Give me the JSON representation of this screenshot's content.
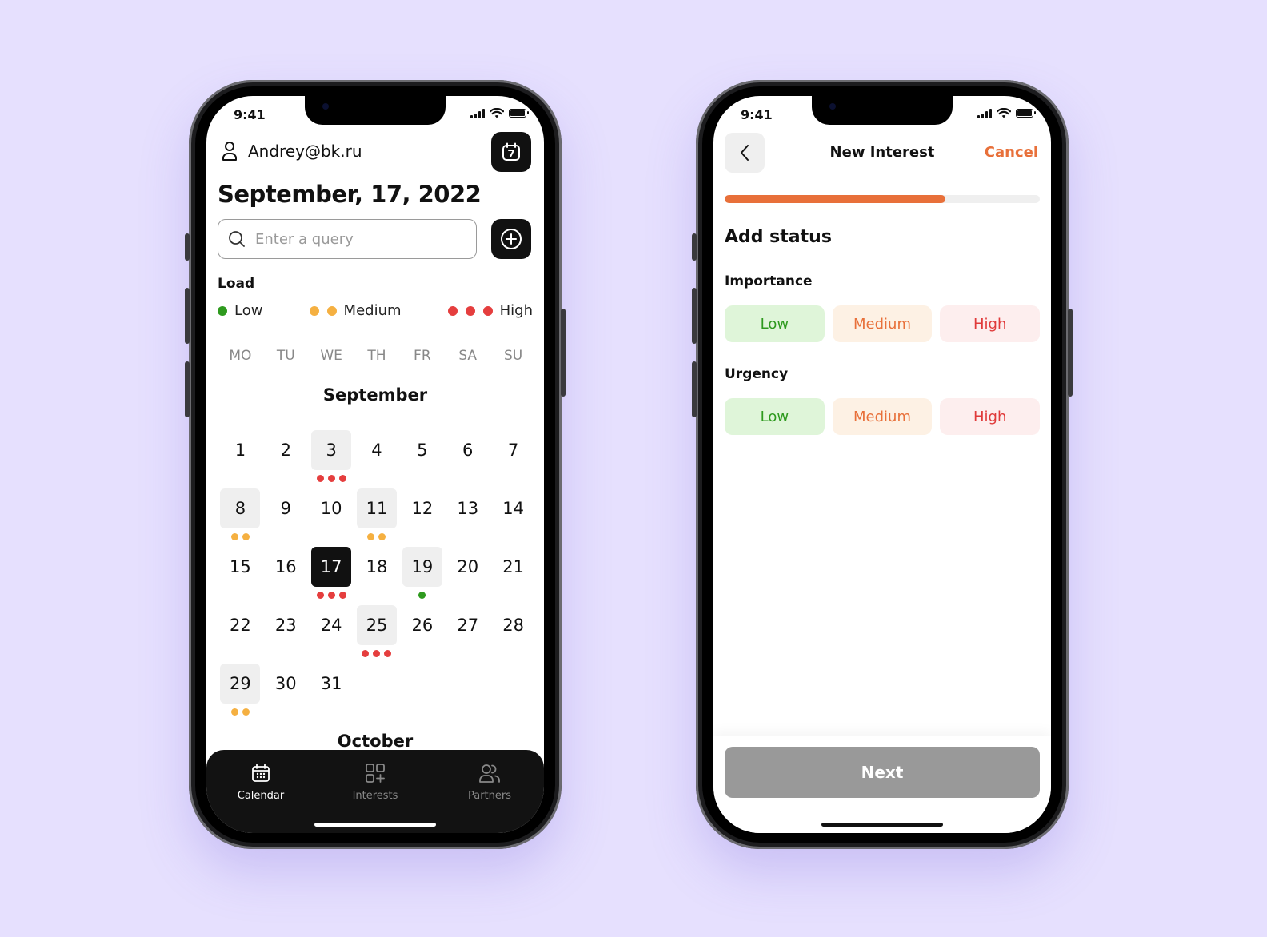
{
  "colors": {
    "background": "#e6e0fe",
    "accent": "#e8703a",
    "low": "#2e9a1e",
    "medium": "#f5b041",
    "high": "#e53e3e"
  },
  "calendar_screen": {
    "status_time": "9:41",
    "user_email": "Andrey@bk.ru",
    "calendar_button_icon": "calendar-7-icon",
    "date_title": "September, 17, 2022",
    "search": {
      "placeholder": "Enter a query",
      "value": ""
    },
    "load": {
      "label": "Load",
      "legend": [
        {
          "label": "Low",
          "level": "low",
          "dots": 1
        },
        {
          "label": "Medium",
          "level": "medium",
          "dots": 2
        },
        {
          "label": "High",
          "level": "high",
          "dots": 3
        }
      ]
    },
    "weekdays": [
      "MO",
      "TU",
      "WE",
      "TH",
      "FR",
      "SA",
      "SU"
    ],
    "month": "September",
    "days": [
      {
        "d": "1"
      },
      {
        "d": "2"
      },
      {
        "d": "3",
        "hl": true,
        "load": "high"
      },
      {
        "d": "4"
      },
      {
        "d": "5"
      },
      {
        "d": "6"
      },
      {
        "d": "7"
      },
      {
        "d": "8",
        "hl": true,
        "load": "medium"
      },
      {
        "d": "9"
      },
      {
        "d": "10"
      },
      {
        "d": "11",
        "hl": true,
        "load": "medium"
      },
      {
        "d": "12"
      },
      {
        "d": "13"
      },
      {
        "d": "14"
      },
      {
        "d": "15"
      },
      {
        "d": "16"
      },
      {
        "d": "17",
        "selected": true,
        "load": "high"
      },
      {
        "d": "18"
      },
      {
        "d": "19",
        "hl": true,
        "load": "low"
      },
      {
        "d": "20"
      },
      {
        "d": "21"
      },
      {
        "d": "22"
      },
      {
        "d": "23"
      },
      {
        "d": "24"
      },
      {
        "d": "25",
        "hl": true,
        "load": "high"
      },
      {
        "d": "26"
      },
      {
        "d": "27"
      },
      {
        "d": "28"
      },
      {
        "d": "29",
        "hl": true,
        "load": "medium"
      },
      {
        "d": "30"
      },
      {
        "d": "31"
      }
    ],
    "next_month": "October",
    "tabs": [
      {
        "label": "Calendar",
        "icon": "calendar-icon",
        "active": true
      },
      {
        "label": "Interests",
        "icon": "grid-plus-icon",
        "active": false
      },
      {
        "label": "Partners",
        "icon": "users-icon",
        "active": false
      }
    ]
  },
  "interest_screen": {
    "status_time": "9:41",
    "title": "New Interest",
    "cancel_label": "Cancel",
    "progress": 0.7,
    "section_title": "Add status",
    "importance": {
      "label": "Importance",
      "options": [
        "Low",
        "Medium",
        "High"
      ]
    },
    "urgency": {
      "label": "Urgency",
      "options": [
        "Low",
        "Medium",
        "High"
      ]
    },
    "next_label": "Next"
  }
}
